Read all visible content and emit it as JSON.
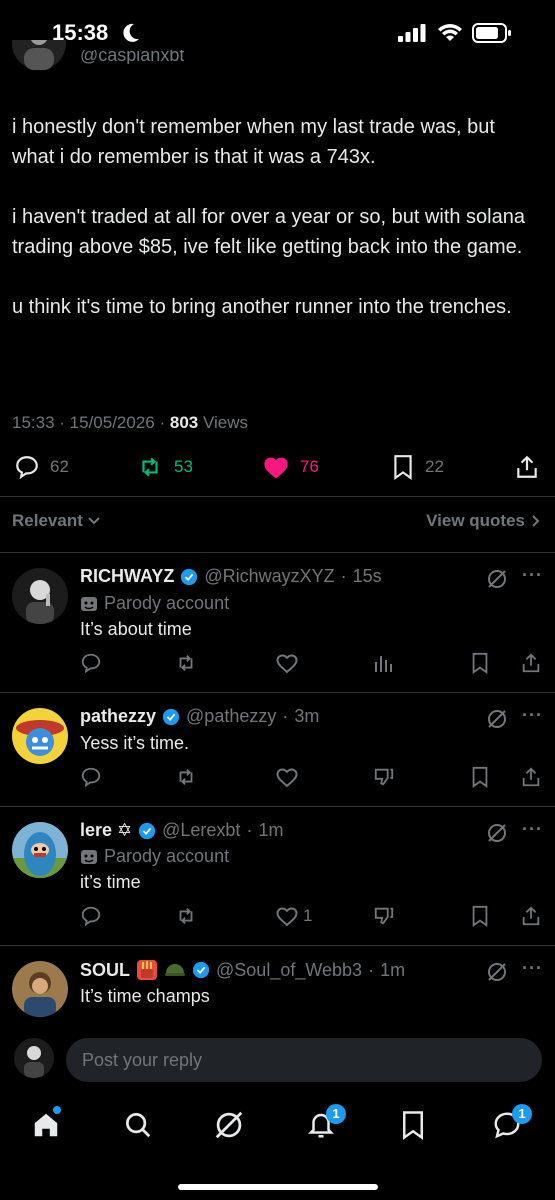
{
  "status_bar": {
    "time": "15:38"
  },
  "header": {
    "handle_partial": "@caspianxbt"
  },
  "tweet": {
    "paragraphs": [
      "i honestly don't remember when my last trade was, but what i do remember is that it was a 743x.",
      "i haven't traded at all for over a year or so, but with solana trading above $85, ive felt like getting back into the game.",
      "u think it's time to bring another runner into the trenches."
    ],
    "time": "15:33",
    "date": "15/05/2026",
    "views_count": "803",
    "views_label": "Views",
    "replies": "62",
    "reposts": "53",
    "likes": "76",
    "bookmarks": "22"
  },
  "sort": {
    "label": "Relevant",
    "view_quotes": "View quotes"
  },
  "replies": [
    {
      "name": "RICHWAYZ",
      "handle": "@RichwayzXYZ",
      "time": "15s",
      "parody": "Parody account",
      "text": "It’s about time"
    },
    {
      "name": "pathezzy",
      "handle": "@pathezzy",
      "time": "3m",
      "text": "Yess it’s time."
    },
    {
      "name": "lere ✡",
      "handle": "@Lerexbt",
      "time": "1m",
      "parody": "Parody account",
      "text": "it’s time",
      "likes": "1"
    },
    {
      "name": "SOUL",
      "handle": "@Soul_of_Webb3",
      "time": "1m",
      "text": "It’s time champs"
    }
  ],
  "reply_box": {
    "placeholder": "Post your reply"
  },
  "tabs": {
    "notifications_badge": "1",
    "messages_badge": "1"
  },
  "colors": {
    "accent": "#1d9bf0",
    "repost": "#00ba7c",
    "like": "#f91880",
    "muted": "#71767b",
    "background": "#000000"
  }
}
